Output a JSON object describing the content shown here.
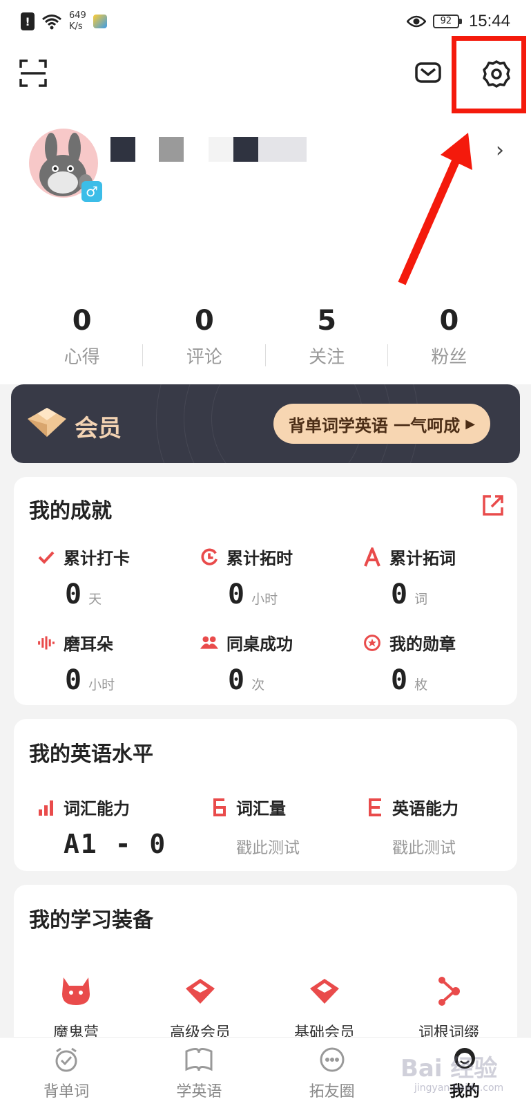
{
  "status_bar": {
    "net_speed_value": "649",
    "net_speed_unit": "K/s",
    "battery": "92",
    "time": "15:44"
  },
  "profile": {
    "gender_symbol": "♂",
    "chevron": "›"
  },
  "stats": [
    {
      "value": "0",
      "label": "心得"
    },
    {
      "value": "0",
      "label": "评论"
    },
    {
      "value": "5",
      "label": "关注"
    },
    {
      "value": "0",
      "label": "粉丝"
    }
  ],
  "vip": {
    "title": "会员",
    "button": "背单词学英语 一气呵成"
  },
  "achievements": {
    "title": "我的成就",
    "items": [
      {
        "label": "累计打卡",
        "value": "0",
        "unit": "天",
        "icon": "check-icon"
      },
      {
        "label": "累计拓时",
        "value": "0",
        "unit": "小时",
        "icon": "clock-icon"
      },
      {
        "label": "累计拓词",
        "value": "0",
        "unit": "词",
        "icon": "letter-a-icon"
      },
      {
        "label": "磨耳朵",
        "value": "0",
        "unit": "小时",
        "icon": "soundwave-icon"
      },
      {
        "label": "同桌成功",
        "value": "0",
        "unit": "次",
        "icon": "people-icon"
      },
      {
        "label": "我的勋章",
        "value": "0",
        "unit": "枚",
        "icon": "medal-icon"
      }
    ]
  },
  "english_level": {
    "title": "我的英语水平",
    "items": [
      {
        "label": "词汇能力",
        "value": "A1 - 0",
        "icon": "bar-chart-icon"
      },
      {
        "label": "词汇量",
        "value": "戳此测试",
        "icon": "digit-six-icon"
      },
      {
        "label": "英语能力",
        "value": "戳此测试",
        "icon": "letter-e-icon"
      }
    ]
  },
  "equipment": {
    "title": "我的学习装备",
    "items": [
      {
        "label": "魔鬼营",
        "icon": "devil-icon"
      },
      {
        "label": "高级会员",
        "icon": "gem-icon"
      },
      {
        "label": "基础会员",
        "icon": "gem-icon"
      },
      {
        "label": "词根词缀",
        "icon": "tree-icon"
      }
    ]
  },
  "bottom_nav": [
    {
      "label": "背单词",
      "icon": "alarm-clock-icon"
    },
    {
      "label": "学英语",
      "icon": "book-icon"
    },
    {
      "label": "拓友圈",
      "icon": "chat-bubble-icon"
    },
    {
      "label": "我的",
      "icon": "person-icon",
      "active": true
    }
  ],
  "watermark": {
    "main": "Bai 经验",
    "sub": "jingyan.baidu.com"
  },
  "colors": {
    "accent_red": "#e94b4b",
    "highlight_red": "#f41a0c",
    "vip_bg": "#383a47",
    "vip_gold": "#f7d6b2"
  }
}
